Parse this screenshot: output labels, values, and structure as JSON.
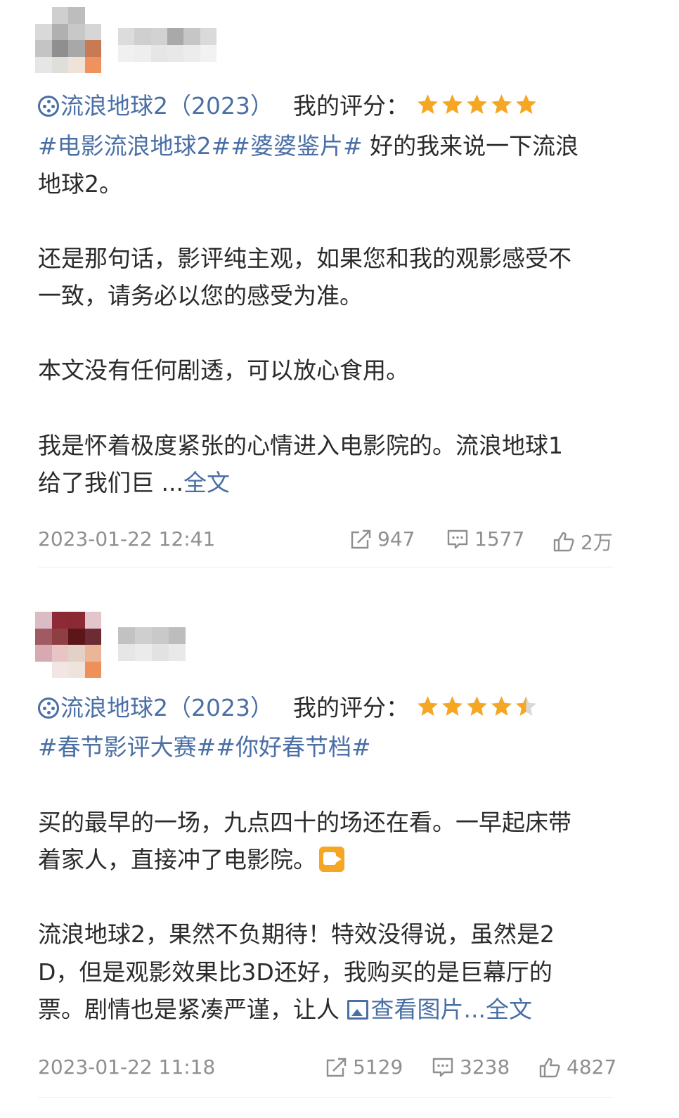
{
  "posts": [
    {
      "movie_tag": "流浪地球2（2023）",
      "rating_label": "我的评分：",
      "rating": 5,
      "lines": [
        {
          "hashtags": "#电影流浪地球2##婆婆鉴片#",
          "text": " 好的我来说一下流浪"
        },
        {
          "text": "地球2。"
        },
        {
          "text": "还是那句话，影评纯主观，如果您和我的观影感受不"
        },
        {
          "text": "一致，请务必以您的感受为准。"
        },
        {
          "text": "本文没有任何剧透，可以放心食用。"
        },
        {
          "text": "我是怀着极度紧张的心情进入电影院的。流浪地球1"
        },
        {
          "text": "给了我们巨 ...",
          "more": "全文"
        }
      ],
      "timestamp": "2023-01-22 12:41",
      "reposts": "947",
      "comments": "1577",
      "likes": "2万"
    },
    {
      "movie_tag": "流浪地球2（2023）",
      "rating_label": "我的评分：",
      "rating": 4.5,
      "lines": [
        {
          "hashtags": "#春节影评大赛##你好春节档#"
        },
        {
          "text": "买的最早的一场，九点四十的场还在看。一早起床带"
        },
        {
          "text": "着家人，直接冲了电影院。"
        },
        {
          "text": "流浪地球2，果然不负期待！特效没得说，虽然是2"
        },
        {
          "text": "D，但是观影效果比3D还好，我购买的是巨幕厅的"
        },
        {
          "text": "票。剧情也是紧凑严谨，让人 ",
          "pic_link": "查看图片",
          "more": "...全文"
        }
      ],
      "timestamp": "2023-01-22 11:18",
      "reposts": "5129",
      "comments": "3238",
      "likes": "4827"
    }
  ],
  "colors": {
    "link": "#4a6fa5",
    "star": "#f5a623",
    "meta": "#8f8f8f"
  }
}
